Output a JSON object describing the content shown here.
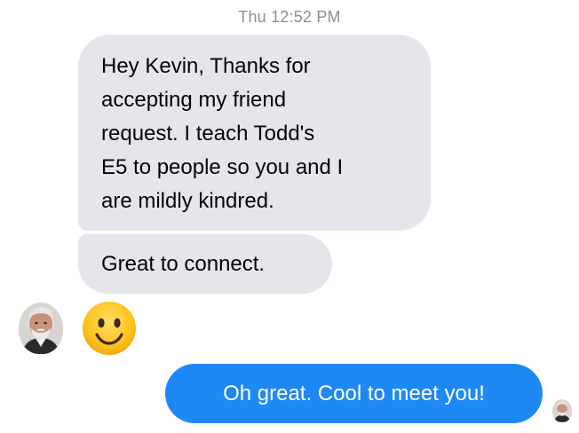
{
  "thread": {
    "timestamp": "Thu 12:52 PM",
    "messages": [
      {
        "direction": "incoming",
        "text": "Hey Kevin, Thanks for\naccepting my friend\nrequest. I teach Todd's\nE5 to people so you and I\nare mildly kindred."
      },
      {
        "direction": "incoming",
        "text": "Great to connect."
      },
      {
        "direction": "incoming",
        "emoji": "slightly-smiling-face"
      },
      {
        "direction": "outgoing",
        "text": "Oh great. Cool to meet you!"
      }
    ]
  },
  "colors": {
    "incoming_bubble": "#e4e6eb",
    "outgoing_bubble": "#1e88f5",
    "timestamp_text": "#8a8d91",
    "message_text": "#050505",
    "emoji_face": "#fcc21b"
  },
  "icons": {
    "incoming_avatar": "sender-avatar-icon",
    "outgoing_avatar": "seen-avatar-icon",
    "emoji": "slightly-smiling-face-icon"
  }
}
